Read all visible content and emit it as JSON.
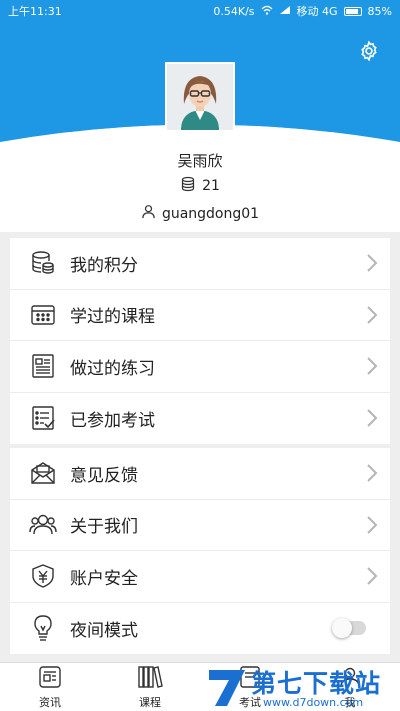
{
  "status_bar": {
    "time": "上午11:31",
    "net_speed": "0.54K/s",
    "carrier": "移动 4G",
    "battery": "85%"
  },
  "profile": {
    "name": "吴雨欣",
    "coins": "21",
    "account": "guangdong01"
  },
  "menu_group_1": [
    {
      "label": "我的积分",
      "icon": "database-icon"
    },
    {
      "label": "学过的课程",
      "icon": "calendar-grid-icon"
    },
    {
      "label": "做过的练习",
      "icon": "document-icon"
    },
    {
      "label": "已参加考试",
      "icon": "checklist-icon"
    }
  ],
  "menu_group_2": [
    {
      "label": "意见反馈",
      "icon": "mail-icon"
    },
    {
      "label": "关于我们",
      "icon": "users-icon"
    },
    {
      "label": "账户安全",
      "icon": "shield-yen-icon"
    },
    {
      "label": "夜间模式",
      "icon": "lightbulb-icon",
      "toggle": false
    }
  ],
  "tabs": [
    {
      "label": "资讯",
      "icon": "news-icon"
    },
    {
      "label": "课程",
      "icon": "books-icon"
    },
    {
      "label": "考试",
      "icon": "exam-icon"
    },
    {
      "label": "我",
      "icon": "me-icon"
    }
  ],
  "watermark": {
    "text": "第七下载站",
    "url": "www.d7down.com"
  },
  "colors": {
    "primary": "#1e98e4",
    "watermark": "#1b6fd1"
  }
}
